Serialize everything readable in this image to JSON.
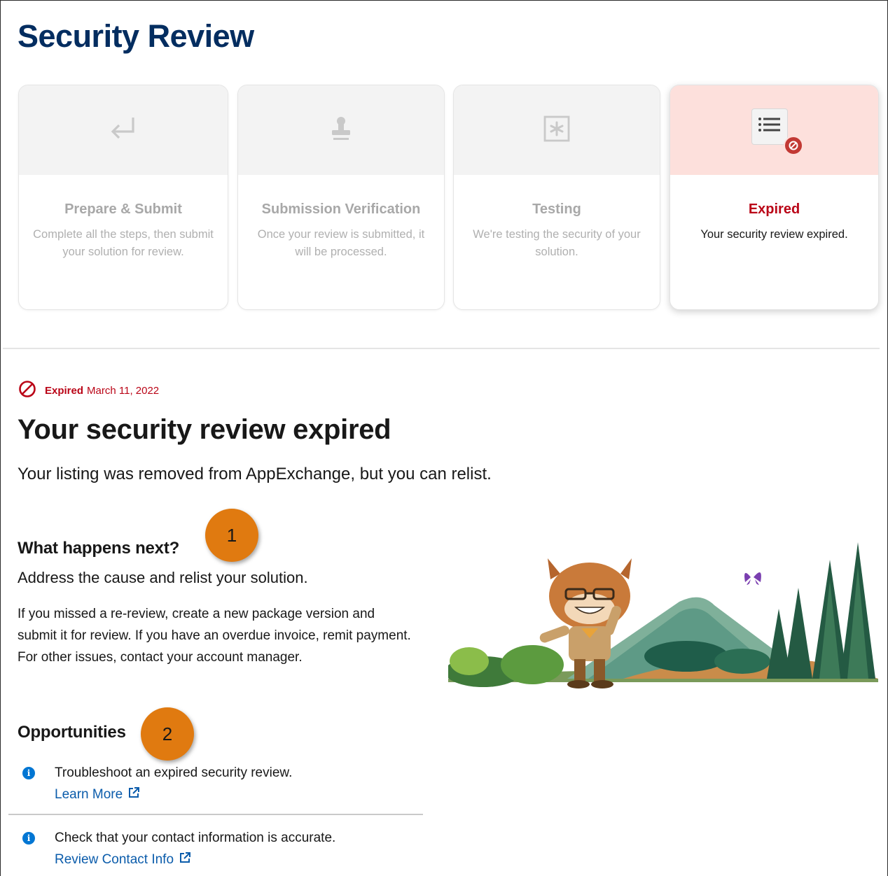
{
  "page": {
    "title": "Security Review"
  },
  "steps": [
    {
      "title": "Prepare & Submit",
      "desc": "Complete all the steps, then submit your solution for review.",
      "icon": "return-arrow-icon"
    },
    {
      "title": "Submission Verification",
      "desc": "Once your review is submitted, it will be processed.",
      "icon": "stamp-icon"
    },
    {
      "title": "Testing",
      "desc": "We're testing the security of your solution.",
      "icon": "asterisk-box-icon"
    },
    {
      "title": "Expired",
      "desc": "Your security review expired.",
      "icon": "list-blocked-icon"
    }
  ],
  "status": {
    "label": "Expired",
    "date": "March 11, 2022",
    "color": "#ba0517"
  },
  "main": {
    "heading": "Your security review expired",
    "subtext": "Your listing was removed from AppExchange, but you can relist."
  },
  "next": {
    "heading": "What happens next?",
    "lead": "Address the cause and relist your solution.",
    "body": "If you missed a re-review, create a new package version and submit it for review. If you have an overdue invoice, remit payment. For other issues, contact your account manager."
  },
  "opportunities": {
    "heading": "Opportunities",
    "items": [
      {
        "text": "Troubleshoot an expired security review.",
        "link": "Learn More"
      },
      {
        "text": "Check that your contact information is accurate.",
        "link": "Review Contact Info"
      }
    ]
  },
  "callouts": [
    "1",
    "2"
  ],
  "colors": {
    "brand": "#032d60",
    "error": "#ba0517",
    "link": "#0b5cab",
    "callout": "#e07a10"
  }
}
